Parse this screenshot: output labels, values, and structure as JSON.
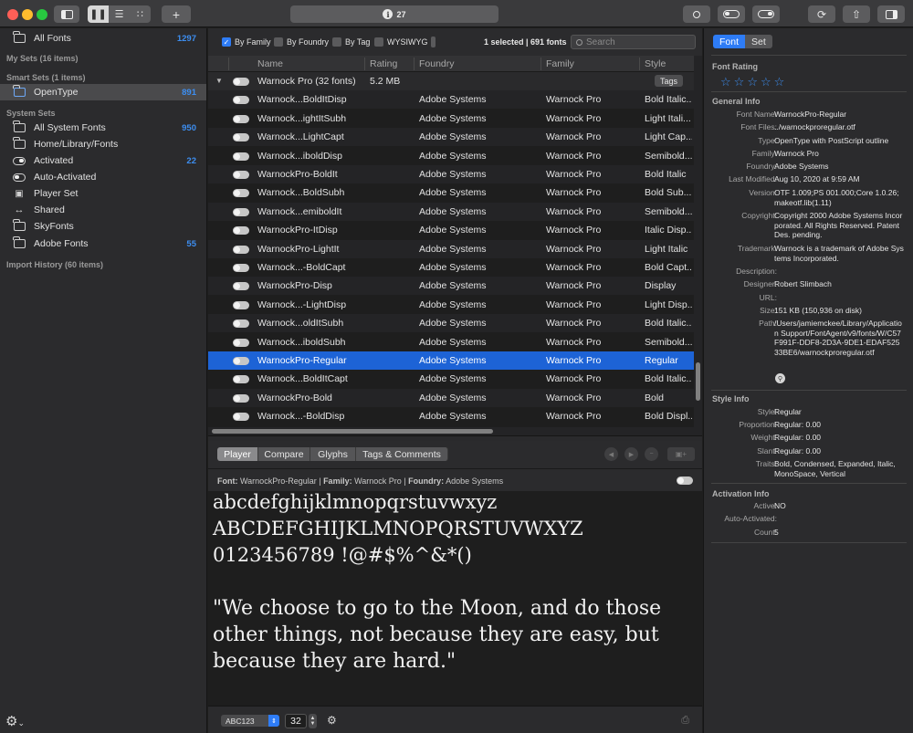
{
  "toolbar": {
    "traffic_colors": [
      "#ff5f57",
      "#febc2e",
      "#28c840"
    ],
    "font_count_badge": "27",
    "add_label": "+"
  },
  "sidebar": {
    "all_fonts": {
      "label": "All Fonts",
      "count": "1297"
    },
    "my_sets_header": "My Sets (16 items)",
    "smart_sets_header": "Smart Sets (1 items)",
    "opentype": {
      "label": "OpenType",
      "count": "891"
    },
    "system_sets_header": "System Sets",
    "items": [
      {
        "label": "All System Fonts",
        "count": "950",
        "icon": "folder-icon"
      },
      {
        "label": "Home/Library/Fonts",
        "count": "",
        "icon": "folder-icon"
      },
      {
        "label": "Activated",
        "count": "22",
        "icon": "toggle-on-icon"
      },
      {
        "label": "Auto-Activated",
        "count": "",
        "icon": "toggle-off-icon"
      },
      {
        "label": "Player Set",
        "count": "",
        "icon": "player-icon"
      },
      {
        "label": "Shared",
        "count": "",
        "icon": "arrows-icon"
      },
      {
        "label": "SkyFonts",
        "count": "",
        "icon": "folder-icon"
      },
      {
        "label": "Adobe Fonts",
        "count": "55",
        "icon": "folder-icon"
      }
    ],
    "import_history_header": "Import History (60 items)"
  },
  "filterbar": {
    "by_family": "By Family",
    "by_foundry": "By Foundry",
    "by_tag": "By Tag",
    "wysiwyg": "WYSIWYG",
    "selection_count": "1 selected | 691 fonts",
    "search_placeholder": "Search"
  },
  "table": {
    "columns": [
      "Name",
      "Rating",
      "Foundry",
      "Family",
      "Style"
    ],
    "group": {
      "name": "Warnock Pro (32 fonts)",
      "size": "5.2 MB",
      "tags_label": "Tags"
    },
    "rows": [
      {
        "name": "Warnock...BoldItDisp",
        "foundry": "Adobe Systems",
        "family": "Warnock Pro",
        "style": "Bold Italic..."
      },
      {
        "name": "Warnock...ightItSubh",
        "foundry": "Adobe Systems",
        "family": "Warnock Pro",
        "style": "Light Itali..."
      },
      {
        "name": "Warnock...LightCapt",
        "foundry": "Adobe Systems",
        "family": "Warnock Pro",
        "style": "Light Cap..."
      },
      {
        "name": "Warnock...iboldDisp",
        "foundry": "Adobe Systems",
        "family": "Warnock Pro",
        "style": "Semibold..."
      },
      {
        "name": "WarnockPro-BoldIt",
        "foundry": "Adobe Systems",
        "family": "Warnock Pro",
        "style": "Bold Italic"
      },
      {
        "name": "Warnock...BoldSubh",
        "foundry": "Adobe Systems",
        "family": "Warnock Pro",
        "style": "Bold Sub..."
      },
      {
        "name": "Warnock...emiboldIt",
        "foundry": "Adobe Systems",
        "family": "Warnock Pro",
        "style": "Semibold..."
      },
      {
        "name": "WarnockPro-ItDisp",
        "foundry": "Adobe Systems",
        "family": "Warnock Pro",
        "style": "Italic Disp..."
      },
      {
        "name": "WarnockPro-LightIt",
        "foundry": "Adobe Systems",
        "family": "Warnock Pro",
        "style": "Light Italic"
      },
      {
        "name": "Warnock...-BoldCapt",
        "foundry": "Adobe Systems",
        "family": "Warnock Pro",
        "style": "Bold Capt..."
      },
      {
        "name": "WarnockPro-Disp",
        "foundry": "Adobe Systems",
        "family": "Warnock Pro",
        "style": "Display"
      },
      {
        "name": "Warnock...-LightDisp",
        "foundry": "Adobe Systems",
        "family": "Warnock Pro",
        "style": "Light Disp..."
      },
      {
        "name": "Warnock...oldItSubh",
        "foundry": "Adobe Systems",
        "family": "Warnock Pro",
        "style": "Bold Italic..."
      },
      {
        "name": "Warnock...iboldSubh",
        "foundry": "Adobe Systems",
        "family": "Warnock Pro",
        "style": "Semibold..."
      },
      {
        "name": "WarnockPro-Regular",
        "foundry": "Adobe Systems",
        "family": "Warnock Pro",
        "style": "Regular",
        "selected": true
      },
      {
        "name": "Warnock...BoldItCapt",
        "foundry": "Adobe Systems",
        "family": "Warnock Pro",
        "style": "Bold Italic..."
      },
      {
        "name": "WarnockPro-Bold",
        "foundry": "Adobe Systems",
        "family": "Warnock Pro",
        "style": "Bold"
      },
      {
        "name": "Warnock...-BoldDisp",
        "foundry": "Adobe Systems",
        "family": "Warnock Pro",
        "style": "Bold Displ..."
      }
    ]
  },
  "player": {
    "tabs": [
      "Player",
      "Compare",
      "Glyphs",
      "Tags & Comments"
    ],
    "font_label": "Font:",
    "font_value": "WarnockPro-Regular",
    "family_label": "Family:",
    "family_value": "Warnock Pro",
    "foundry_label": "Foundry:",
    "foundry_value": "Adobe Systems",
    "preview_lower": "abcdefghijklmnopqrstuvwxyz",
    "preview_upper": "ABCDEFGHIJKLMNOPQRSTUVWXYZ",
    "preview_digits": "0123456789 !@#$%^&*()",
    "preview_quote": "\"We choose to go to the Moon, and do those other things, not because they are easy, but because they are hard.\"",
    "sample_select": "ABC123",
    "size_value": "32"
  },
  "inspector": {
    "tabs": [
      "Font",
      "Set"
    ],
    "font_rating_header": "Font Rating",
    "general_info_header": "General Info",
    "general": [
      {
        "k": "Font Name:",
        "v": "WarnockPro-Regular"
      },
      {
        "k": "Font Files:",
        "v": "../warnockproregular.otf"
      },
      {
        "k": "Type:",
        "v": "OpenType with PostScript outline"
      },
      {
        "k": "Family:",
        "v": "Warnock Pro"
      },
      {
        "k": "Foundry:",
        "v": "Adobe Systems"
      },
      {
        "k": "Last Modified:",
        "v": "Aug 10, 2020 at 9:59 AM"
      },
      {
        "k": "Version:",
        "v": "OTF 1.009;PS 001.000;Core 1.0.26; makeotf.lib(1.11)"
      },
      {
        "k": "Copyright:",
        "v": "Copyright  2000 Adobe Systems Incorporated. All Rights Reserved. Patent Des. pending."
      },
      {
        "k": "Trademark:",
        "v": "Warnock is a trademark of Adobe Systems Incorporated."
      },
      {
        "k": "Description:",
        "v": ""
      },
      {
        "k": "Designer:",
        "v": "Robert Slimbach"
      },
      {
        "k": "URL:",
        "v": ""
      },
      {
        "k": "Size:",
        "v": "151 KB (150,936 on disk)"
      },
      {
        "k": "Path:",
        "v": "/Users/jamiemckee/Library/Application Support/FontAgent/v9/fonts/W/C57F991F-DDF8-2D3A-9DE1-EDAF52533BE6/warnockproregular.otf"
      }
    ],
    "style_info_header": "Style Info",
    "style": [
      {
        "k": "Style:",
        "v": "Regular"
      },
      {
        "k": "Proportion:",
        "v": "Regular: 0.00"
      },
      {
        "k": "Weight:",
        "v": "Regular: 0.00"
      },
      {
        "k": "Slant:",
        "v": "Regular: 0.00"
      },
      {
        "k": "Traits:",
        "v": "Bold, Condensed, Expanded, Italic, MonoSpace, Vertical"
      }
    ],
    "activation_info_header": "Activation Info",
    "activation": [
      {
        "k": "Active:",
        "v": "NO"
      },
      {
        "k": "Auto-Activated:",
        "v": ""
      },
      {
        "k": "Count:",
        "v": "5"
      }
    ]
  }
}
